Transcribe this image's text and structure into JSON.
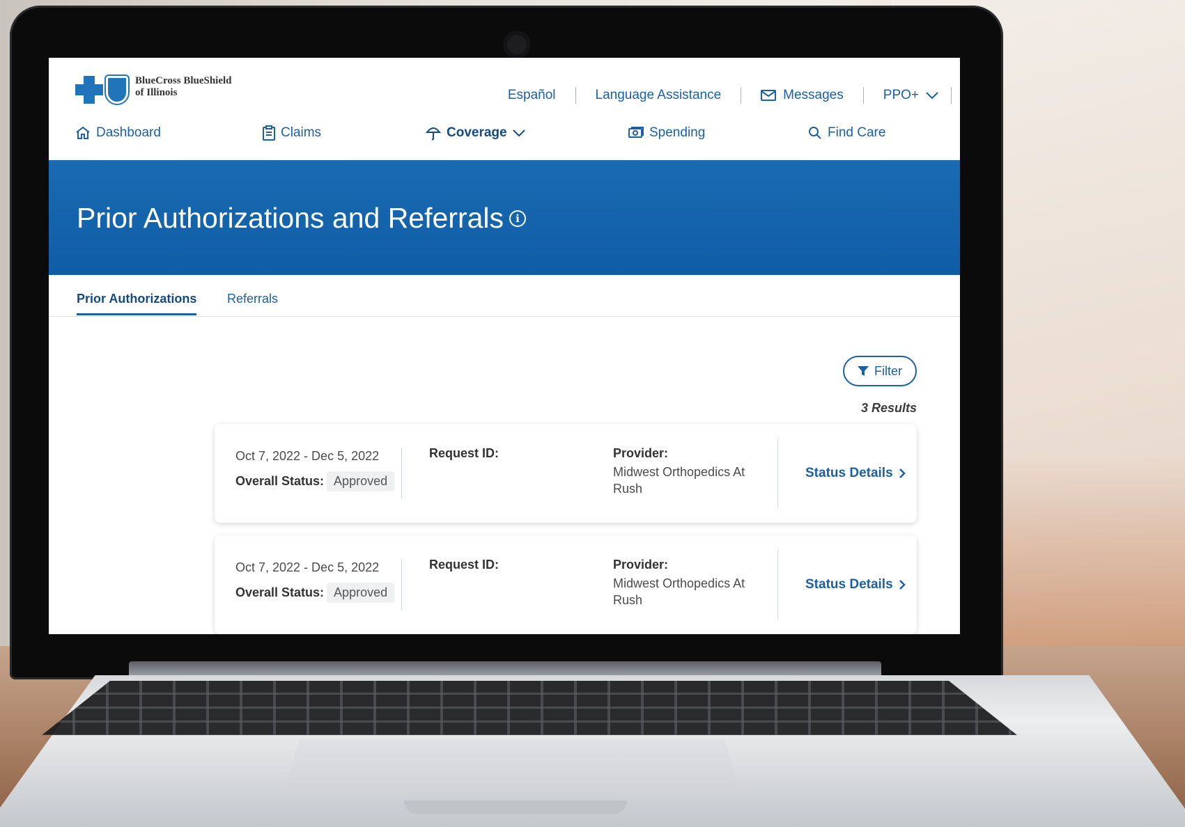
{
  "header": {
    "logo_line1": "BlueCross BlueShield",
    "logo_line2": "of Illinois",
    "utility_links": {
      "espanol": "Español",
      "language_assistance": "Language Assistance",
      "messages": "Messages",
      "plan": "PPO+"
    }
  },
  "nav": {
    "dashboard": "Dashboard",
    "claims": "Claims",
    "coverage": "Coverage",
    "spending": "Spending",
    "find_care": "Find Care"
  },
  "hero": {
    "title": "Prior Authorizations and Referrals"
  },
  "tabs": {
    "prior_authorizations": "Prior Authorizations",
    "referrals": "Referrals"
  },
  "filter": {
    "label": "Filter"
  },
  "results_count": "3 Results",
  "cards": [
    {
      "dates": "Oct 7, 2022 - Dec 5, 2022",
      "status_label": "Overall Status:",
      "status_value": "Approved",
      "request_id_label": "Request ID:",
      "provider_label": "Provider:",
      "provider_name": "Midwest Orthopedics At Rush",
      "details_link": "Status Details"
    },
    {
      "dates": "Oct 7, 2022 - Dec 5, 2022",
      "status_label": "Overall Status:",
      "status_value": "Approved",
      "request_id_label": "Request ID:",
      "provider_label": "Provider:",
      "provider_name": "Midwest Orthopedics At Rush",
      "details_link": "Status Details"
    }
  ],
  "colors": {
    "brand_blue": "#1b5fa4",
    "hero_blue": "#1567b0",
    "badge_bg": "#eef0f2"
  }
}
